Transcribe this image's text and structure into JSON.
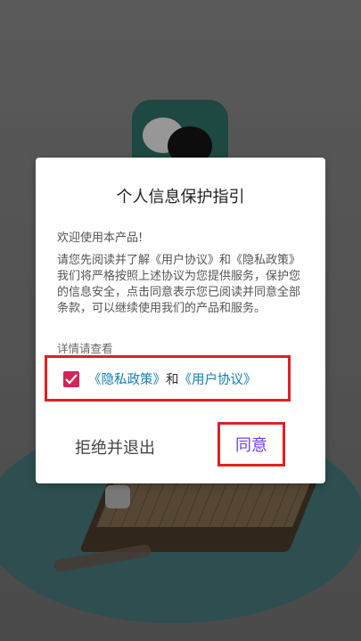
{
  "dialog": {
    "title": "个人信息保护指引",
    "welcome": "欢迎使用本产品!",
    "body": "请您先阅读并了解《用户协议》和《隐私政策》我们将严格按照上述协议为您提供服务，保护您的信息安全，点击同意表示您已阅读并同意全部条款，可以继续使用我们的产品和服务。",
    "details_label": "详情请查看",
    "privacy_link": "《隐私政策》",
    "and_text": "和",
    "user_agreement_link": "《用户协议》",
    "checkbox_checked": true,
    "refuse_button": "拒绝并退出",
    "agree_button": "同意"
  },
  "colors": {
    "accent": "#d0245a",
    "link": "#0f7fb0",
    "agree_text": "#6f3ff0",
    "highlight_border": "#e02020"
  },
  "icons": {
    "checkbox": "check-icon"
  }
}
